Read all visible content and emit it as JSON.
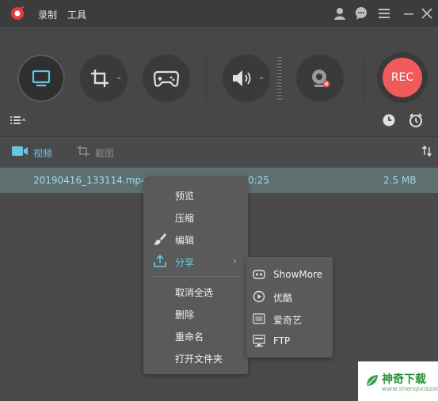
{
  "menu": {
    "record": "录制",
    "tools": "工具"
  },
  "toolbar": {
    "rec_label": "REC"
  },
  "tabs": {
    "video": "视频",
    "screenshot": "截图"
  },
  "files": [
    {
      "name": "20190416_133114.mp4",
      "duration_fragment": "0:25",
      "size": "2.5 MB"
    }
  ],
  "context_menu": {
    "preview": "预览",
    "compress": "压缩",
    "edit": "编辑",
    "share": "分享",
    "deselect_all": "取消全选",
    "delete": "删除",
    "rename": "重命名",
    "open_folder": "打开文件夹"
  },
  "share_submenu": {
    "showmore": "ShowMore",
    "youku": "优酷",
    "iqiyi": "爱奇艺",
    "ftp": "FTP"
  },
  "watermark": {
    "brand": "神奇下载",
    "url": "www.shenqixiazai.com"
  },
  "colors": {
    "accent": "#66c7e4",
    "rec": "#ef5a5a",
    "file_text": "#9fdcef"
  }
}
